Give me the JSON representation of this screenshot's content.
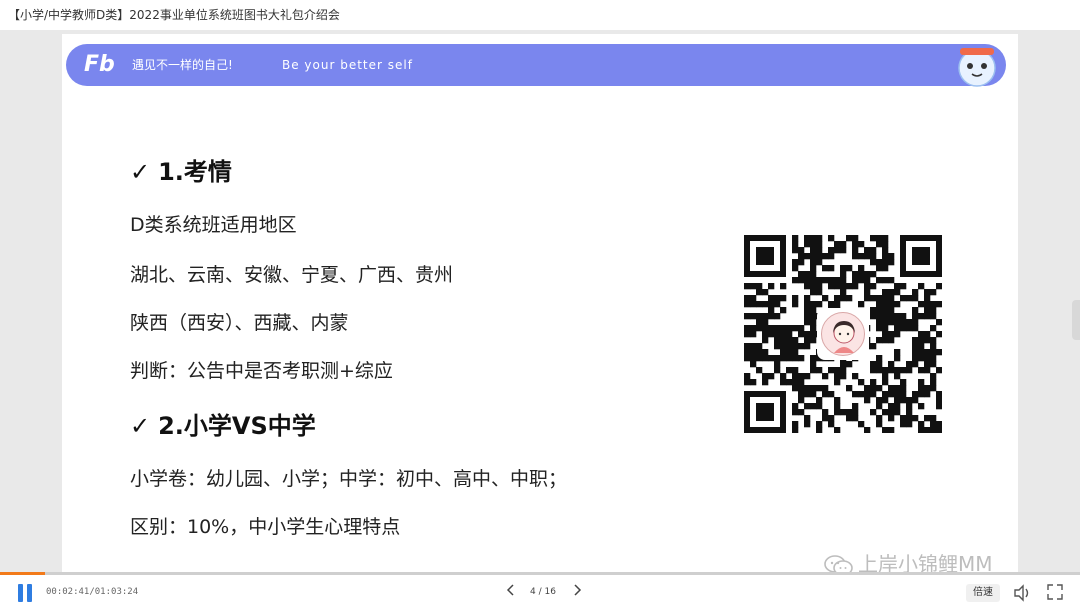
{
  "window": {
    "title": "【小学/中学教师D类】2022事业单位系统班图书大礼包介绍会"
  },
  "banner": {
    "logo": "Fb",
    "slogan_cn": "遇见不一样的自己!",
    "slogan_en": "Be your better self"
  },
  "slide": {
    "section1": {
      "check": "✓",
      "heading": "1.考情",
      "lines": [
        "D类系统班适用地区",
        "湖北、云南、安徽、宁夏、广西、贵州",
        "陕西（西安）、西藏、内蒙",
        "判断：公告中是否考职测+综应"
      ]
    },
    "section2": {
      "check": "✓",
      "heading": "2.小学VS中学",
      "lines": [
        "小学卷：幼儿园、小学；中学：初中、高中、中职；",
        "区别：10%，中小学生心理特点"
      ]
    }
  },
  "watermark": {
    "text": "上岸小锦鲤MM"
  },
  "player": {
    "time": "00:02:41/01:03:24",
    "progress_fraction": 0.042,
    "page": "4 / 16",
    "prev_icon": "chevron-left-icon",
    "next_icon": "chevron-right-icon",
    "speed_label": "倍速",
    "accent": "#2f7de1",
    "progress_color": "#f27a1a"
  }
}
